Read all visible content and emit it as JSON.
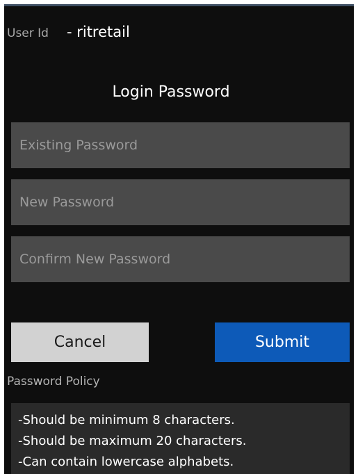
{
  "header": {
    "user_id_label": "User Id",
    "user_id_value": "- ritretail"
  },
  "form": {
    "title": "Login Password",
    "existing_password": {
      "placeholder": "Existing Password",
      "value": ""
    },
    "new_password": {
      "placeholder": "New Password",
      "value": ""
    },
    "confirm_password": {
      "placeholder": "Confirm New Password",
      "value": ""
    }
  },
  "actions": {
    "cancel_label": "Cancel",
    "submit_label": "Submit"
  },
  "policy": {
    "label": "Password Policy",
    "items": [
      "-Should be minimum 8 characters.",
      "-Should be maximum 20 characters.",
      "-Can contain lowercase alphabets."
    ]
  },
  "colors": {
    "background": "#0e0e0e",
    "input": "#4a4a4a",
    "cancel": "#d2d2d2",
    "submit": "#0d5ab8"
  }
}
